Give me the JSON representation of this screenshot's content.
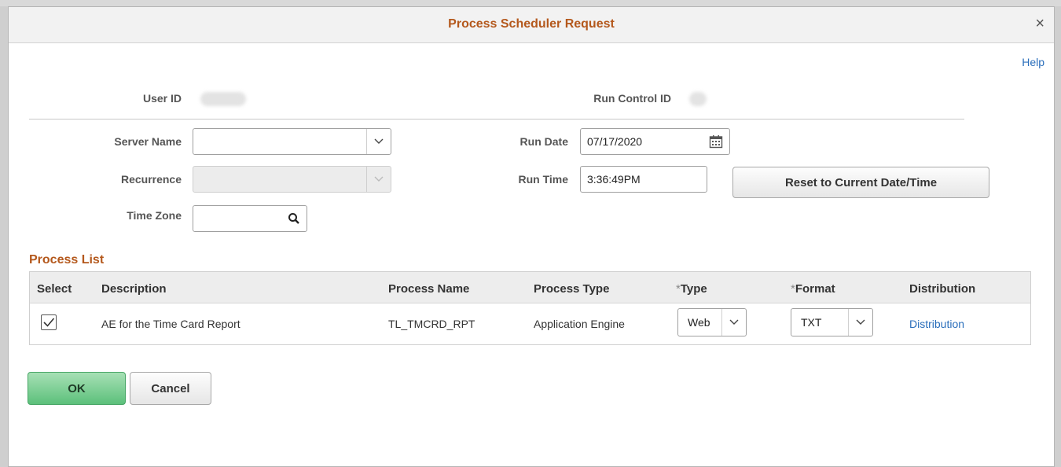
{
  "dialog": {
    "title": "Process Scheduler Request",
    "close_glyph": "×",
    "help_link": "Help"
  },
  "header": {
    "user_id_label": "User ID",
    "run_control_id_label": "Run Control ID"
  },
  "form": {
    "server_name_label": "Server Name",
    "server_name_value": "",
    "recurrence_label": "Recurrence",
    "recurrence_value": "",
    "time_zone_label": "Time Zone",
    "time_zone_value": "",
    "run_date_label": "Run Date",
    "run_date_value": "07/17/2020",
    "run_time_label": "Run Time",
    "run_time_value": "3:36:49PM",
    "reset_button": "Reset to Current Date/Time"
  },
  "process_list": {
    "title": "Process List",
    "columns": {
      "select": "Select",
      "description": "Description",
      "process_name": "Process Name",
      "process_type": "Process Type",
      "type_marker": "*",
      "type": "Type",
      "format_marker": "*",
      "format": "Format",
      "distribution": "Distribution"
    },
    "rows": [
      {
        "selected": true,
        "description": "AE for the Time Card Report",
        "process_name": "TL_TMCRD_RPT",
        "process_type": "Application Engine",
        "type": "Web",
        "format": "TXT",
        "distribution": "Distribution"
      }
    ]
  },
  "buttons": {
    "ok": "OK",
    "cancel": "Cancel"
  },
  "icons": {
    "close": "close-icon",
    "dropdown": "chevron-down-icon",
    "calendar": "calendar-icon",
    "search": "search-icon",
    "check": "checkmark-icon"
  },
  "colors": {
    "title": "#b4581c",
    "link": "#2a6ebb",
    "ok_button": "#5cc07b"
  }
}
